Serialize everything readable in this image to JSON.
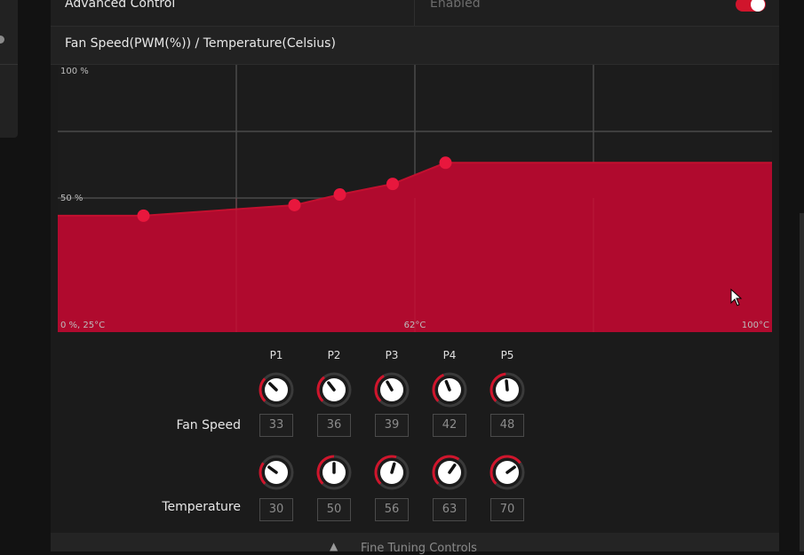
{
  "advanced_control": {
    "label": "Advanced Control",
    "value": "Enabled",
    "toggle_on": true
  },
  "section": {
    "title": "Fan Speed(PWM(%)) / Temperature(Celsius)"
  },
  "colors": {
    "accent": "#d0152c",
    "fill": "#b00a2e",
    "point": "#e8173d",
    "panel": "#1b1b1b",
    "grid": "#4a4a4a"
  },
  "chart_data": {
    "type": "area",
    "tick_labels": {
      "y_top": "100 %",
      "y_mid": "50 %",
      "origin": "0 %, 25°C",
      "x_mid": "62°C",
      "x_right": "100°C"
    },
    "xlim": [
      25,
      100
    ],
    "ylim": [
      0,
      100
    ],
    "points": [
      {
        "name": "P1",
        "x": 30,
        "y": 33
      },
      {
        "name": "P2",
        "x": 50,
        "y": 36
      },
      {
        "name": "P3",
        "x": 56,
        "y": 39
      },
      {
        "name": "P4",
        "x": 63,
        "y": 42
      },
      {
        "name": "P5",
        "x": 70,
        "y": 48
      }
    ],
    "grid": true
  },
  "controls": {
    "fan_speed_label": "Fan Speed",
    "temperature_label": "Temperature",
    "points": [
      {
        "label": "P1",
        "speed": "33",
        "temp": "30"
      },
      {
        "label": "P2",
        "speed": "36",
        "temp": "50"
      },
      {
        "label": "P3",
        "speed": "39",
        "temp": "56"
      },
      {
        "label": "P4",
        "speed": "42",
        "temp": "63"
      },
      {
        "label": "P5",
        "speed": "48",
        "temp": "70"
      }
    ]
  },
  "footer": {
    "label": "Fine Tuning Controls",
    "icon": "chevron-up-icon"
  }
}
